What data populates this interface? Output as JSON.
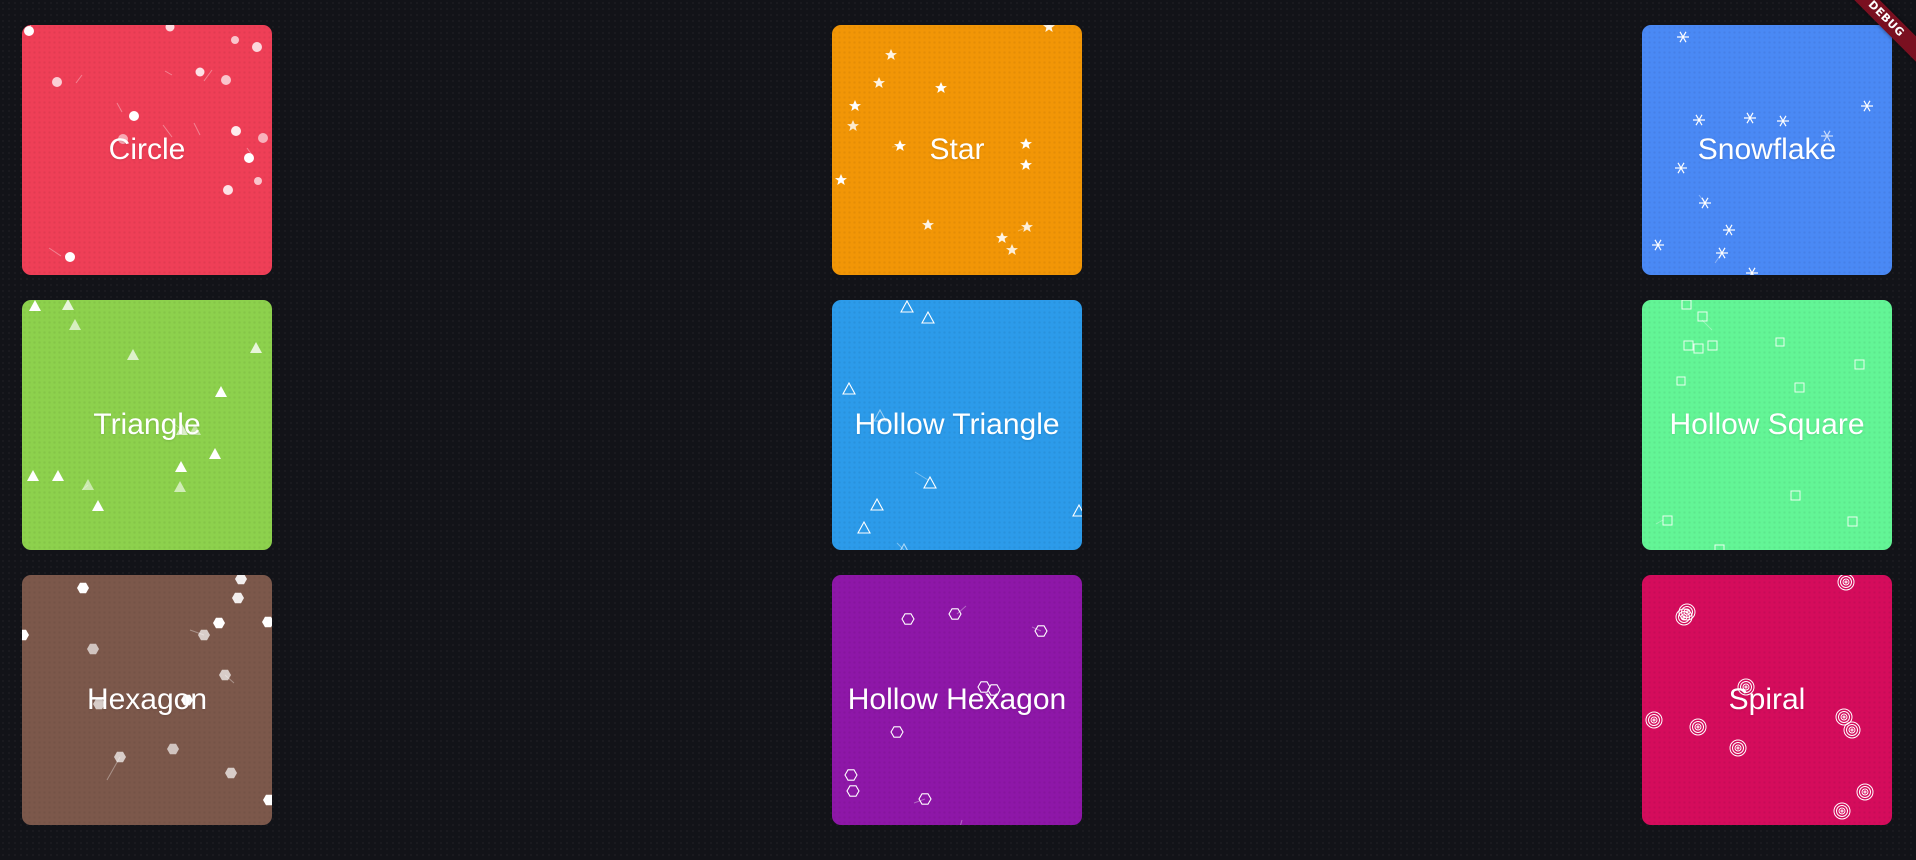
{
  "debug_banner": "DEBUG",
  "tiles": [
    {
      "label": "Circle",
      "shape": "circle-icon",
      "color": "#EF3F57"
    },
    {
      "label": "Star",
      "shape": "star-icon",
      "color": "#F29606"
    },
    {
      "label": "Snowflake",
      "shape": "snowflake-icon",
      "color": "#4A89F5"
    },
    {
      "label": "Triangle",
      "shape": "triangle-icon",
      "color": "#8DD14D"
    },
    {
      "label": "Hollow Triangle",
      "shape": "hollow-triangle-icon",
      "color": "#2C9BEA"
    },
    {
      "label": "Hollow Square",
      "shape": "hollow-square-icon",
      "color": "#63F596"
    },
    {
      "label": "Hexagon",
      "shape": "hexagon-icon",
      "color": "#7C584B"
    },
    {
      "label": "Hollow Hexagon",
      "shape": "hollow-hexagon-icon",
      "color": "#8E17A8"
    },
    {
      "label": "Spiral",
      "shape": "spiral-icon",
      "color": "#D50C5C"
    }
  ]
}
